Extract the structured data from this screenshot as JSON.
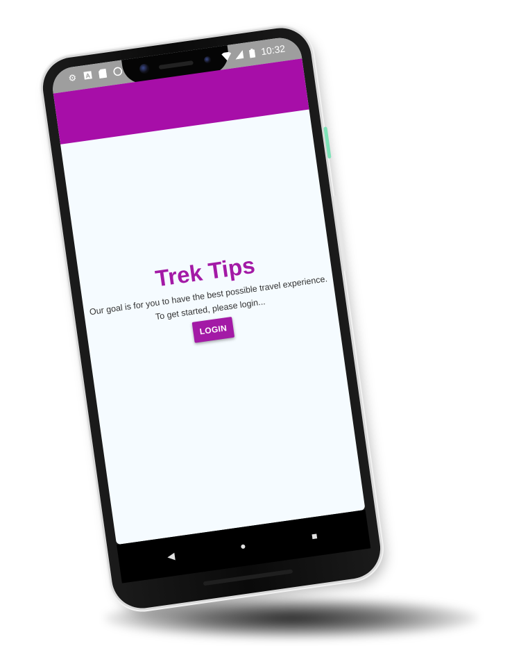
{
  "status_bar": {
    "time": "10:32",
    "left_icons": [
      "gear-icon",
      "a-icon",
      "sd-card-icon",
      "circle-icon"
    ],
    "right_icons": [
      "wifi-icon",
      "signal-icon",
      "battery-icon"
    ]
  },
  "app": {
    "title": "Trek Tips",
    "tagline": "Our goal is for you to have the best possible travel experience.",
    "prompt": "To get started, please login...",
    "login_label": "LOGIN"
  },
  "colors": {
    "accent": "#a70ea8",
    "title": "#a31aa6",
    "background": "#f5fbff"
  },
  "nav": {
    "buttons": [
      "back-icon",
      "home-icon",
      "recents-icon"
    ]
  }
}
